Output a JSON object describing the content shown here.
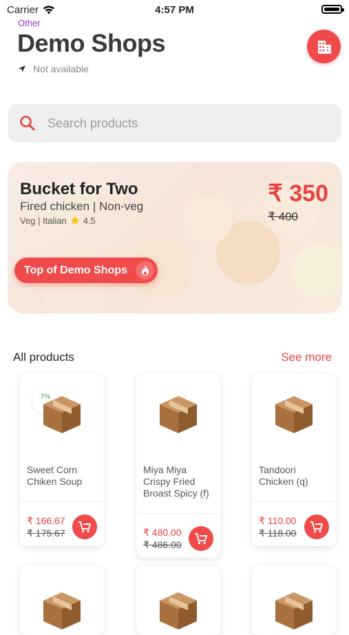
{
  "status_bar": {
    "carrier": "Carrier",
    "time": "4:57 PM"
  },
  "header": {
    "category": "Other",
    "title": "Demo Shops",
    "location": "Not available"
  },
  "search": {
    "placeholder": "Search products"
  },
  "banner": {
    "title": "Bucket for Two",
    "subtitle": "Fired chicken | Non-veg",
    "meta": "Veg | Italian",
    "rating": "4.5",
    "price": "₹ 350",
    "old_price": "₹ 400",
    "button_label": "Top of Demo Shops"
  },
  "section": {
    "title": "All products",
    "see_more": "See more"
  },
  "products": [
    {
      "name": "Sweet Corn Chiken Soup",
      "price": "₹ 166.67",
      "old_price": "₹ 175.67",
      "discount": "7%"
    },
    {
      "name": "Miya Miya Crispy Fried Broast Spicy (f)",
      "price": "₹ 480.00",
      "old_price": "₹ 486.00"
    },
    {
      "name": "Tandoori Chicken (q)",
      "price": "₹ 110.00",
      "old_price": "₹ 118.00"
    }
  ],
  "colors": {
    "accent": "#f04a4a",
    "price": "#e8423f",
    "category": "#9b30d9",
    "discount": "#2fa84f"
  }
}
